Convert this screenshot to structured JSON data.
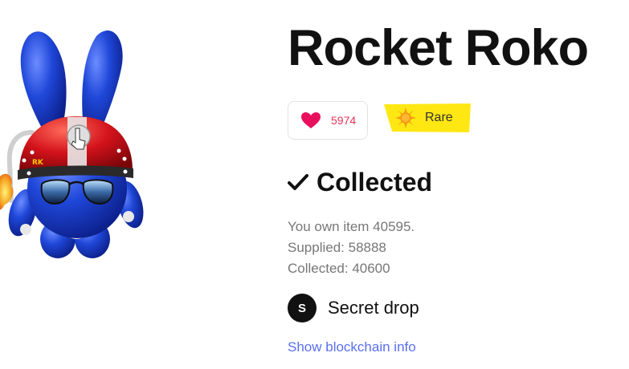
{
  "item": {
    "title": "Rocket Roko",
    "likes": "5974",
    "rarity": "Rare"
  },
  "status": {
    "title": "Collected",
    "owned_line": "You own item 40595.",
    "supplied_line": "Supplied: 58888",
    "collected_line": "Collected: 40600"
  },
  "creator": {
    "avatar_letter": "S",
    "name": "Secret drop"
  },
  "links": {
    "blockchain": "Show blockchain info"
  },
  "icons": {
    "like": "heart-icon",
    "rarity": "star-icon",
    "status": "checkmark-icon"
  },
  "colors": {
    "heart": "#e8345a",
    "rarity_badge": "#ffe714",
    "link": "#5a6ff0",
    "avatar": "#111111"
  }
}
